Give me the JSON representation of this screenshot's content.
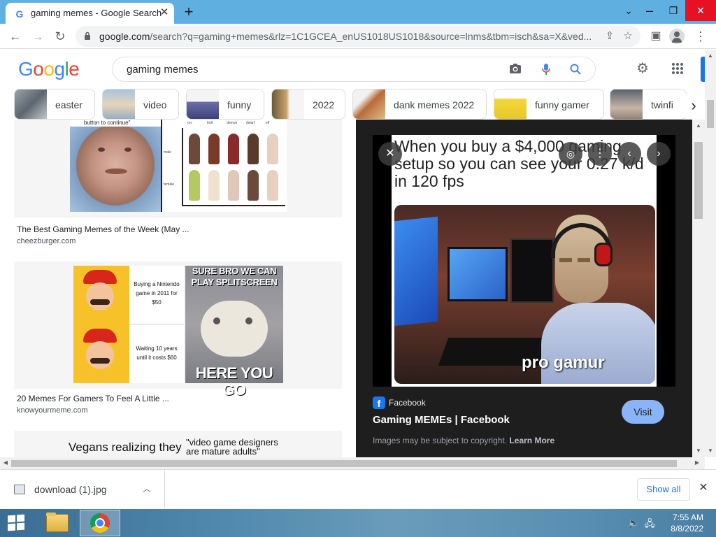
{
  "browser": {
    "tab_title": "gaming memes - Google Search",
    "favicon": "G",
    "url_host": "google.com",
    "url_rest": "/search?q=gaming+memes&rlz=1C1GCEA_enUS1018US1018&source=lnms&tbm=isch&sa=X&ved..."
  },
  "google": {
    "logo_letters": [
      "G",
      "o",
      "o",
      "g",
      "l",
      "e"
    ],
    "logo_colors": [
      "#4285f4",
      "#ea4335",
      "#fbbc05",
      "#4285f4",
      "#34a853",
      "#ea4335"
    ],
    "query": "gaming memes",
    "chips": [
      "easter",
      "video",
      "funny",
      "2022",
      "dank memes 2022",
      "funny gamer",
      "twinfi"
    ]
  },
  "results": [
    {
      "title": "The Best Gaming Memes of the Week (May ...",
      "source": "cheezburger.com",
      "top_text": "button to continue\""
    },
    {
      "title": "20 Memes For Gamers To Feel A Little ...",
      "source": "knowyourmeme.com",
      "meme_mid": "Buying a Nintendo game in 2011 for $50",
      "meme_mid2": "Waiting 10 years until it costs $60",
      "meme_top": "SURE BRO WE CAN PLAY SPLITSCREEN",
      "meme_bottom": "HERE YOU GO"
    },
    {
      "text_left": "Vegans realizing they",
      "text_right": "\"video game designers are mature adults\""
    }
  ],
  "chart_grid": {
    "headers": [
      "orc",
      "troll",
      "demon",
      "dwarf",
      "elf"
    ],
    "rows": [
      "male",
      "female"
    ]
  },
  "preview": {
    "caption": "When you buy a $4,000 gaming setup so you can see your 0.27 k/d in 120 fps",
    "overlay_text": "pro gamur",
    "source_name": "Facebook",
    "title": "Gaming MEMEs | Facebook",
    "visit_label": "Visit",
    "copyright": "Images may be subject to copyright.",
    "learn_more": "Learn More"
  },
  "downloads": {
    "file_name": "download (1).jpg",
    "show_all": "Show all"
  },
  "taskbar": {
    "time": "7:55 AM",
    "date": "8/8/2022"
  }
}
